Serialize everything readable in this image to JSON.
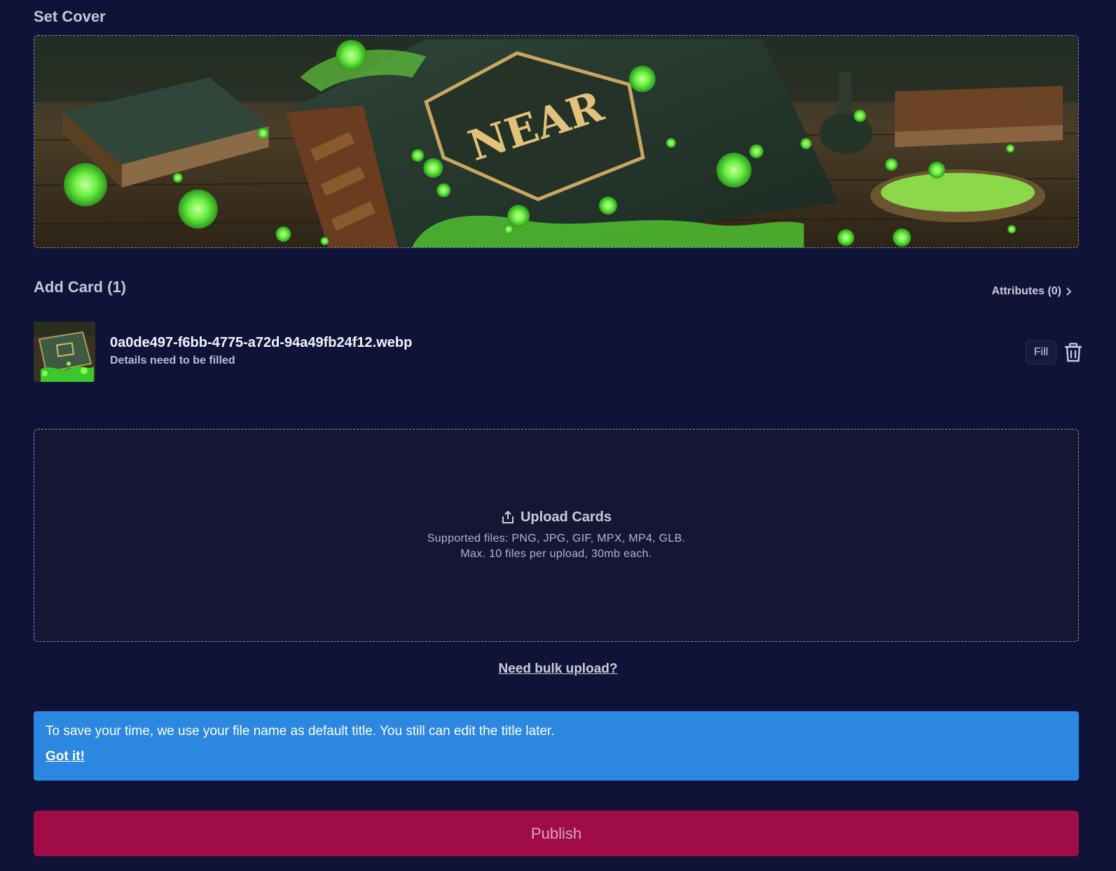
{
  "cover": {
    "title": "Set Cover",
    "image_label": "NEAR",
    "image_description_icon": "cover-image"
  },
  "cards": {
    "title": "Add Card (1)",
    "attributes_label": "Attributes (0)",
    "items": [
      {
        "file_name": "0a0de497-f6bb-4775-a72d-94a49fb24f12.webp",
        "status": "Details need to be filled",
        "fill_label": "Fill"
      }
    ]
  },
  "upload": {
    "title": "Upload Cards",
    "line1": "Supported files: PNG, JPG, GIF, MPX, MP4, GLB.",
    "line2": "Max. 10 files per upload, 30mb each.",
    "icon": "upload-icon"
  },
  "bulk_link": "Need bulk upload?",
  "banner": {
    "text": "To save your time, we use your file name as default title. You still can edit the title later.",
    "dismiss": "Got it!"
  },
  "publish_label": "Publish",
  "colors": {
    "background": "#101338",
    "banner": "#2b87e0",
    "publish": "#a00d46",
    "slime": "#5ef03c"
  }
}
